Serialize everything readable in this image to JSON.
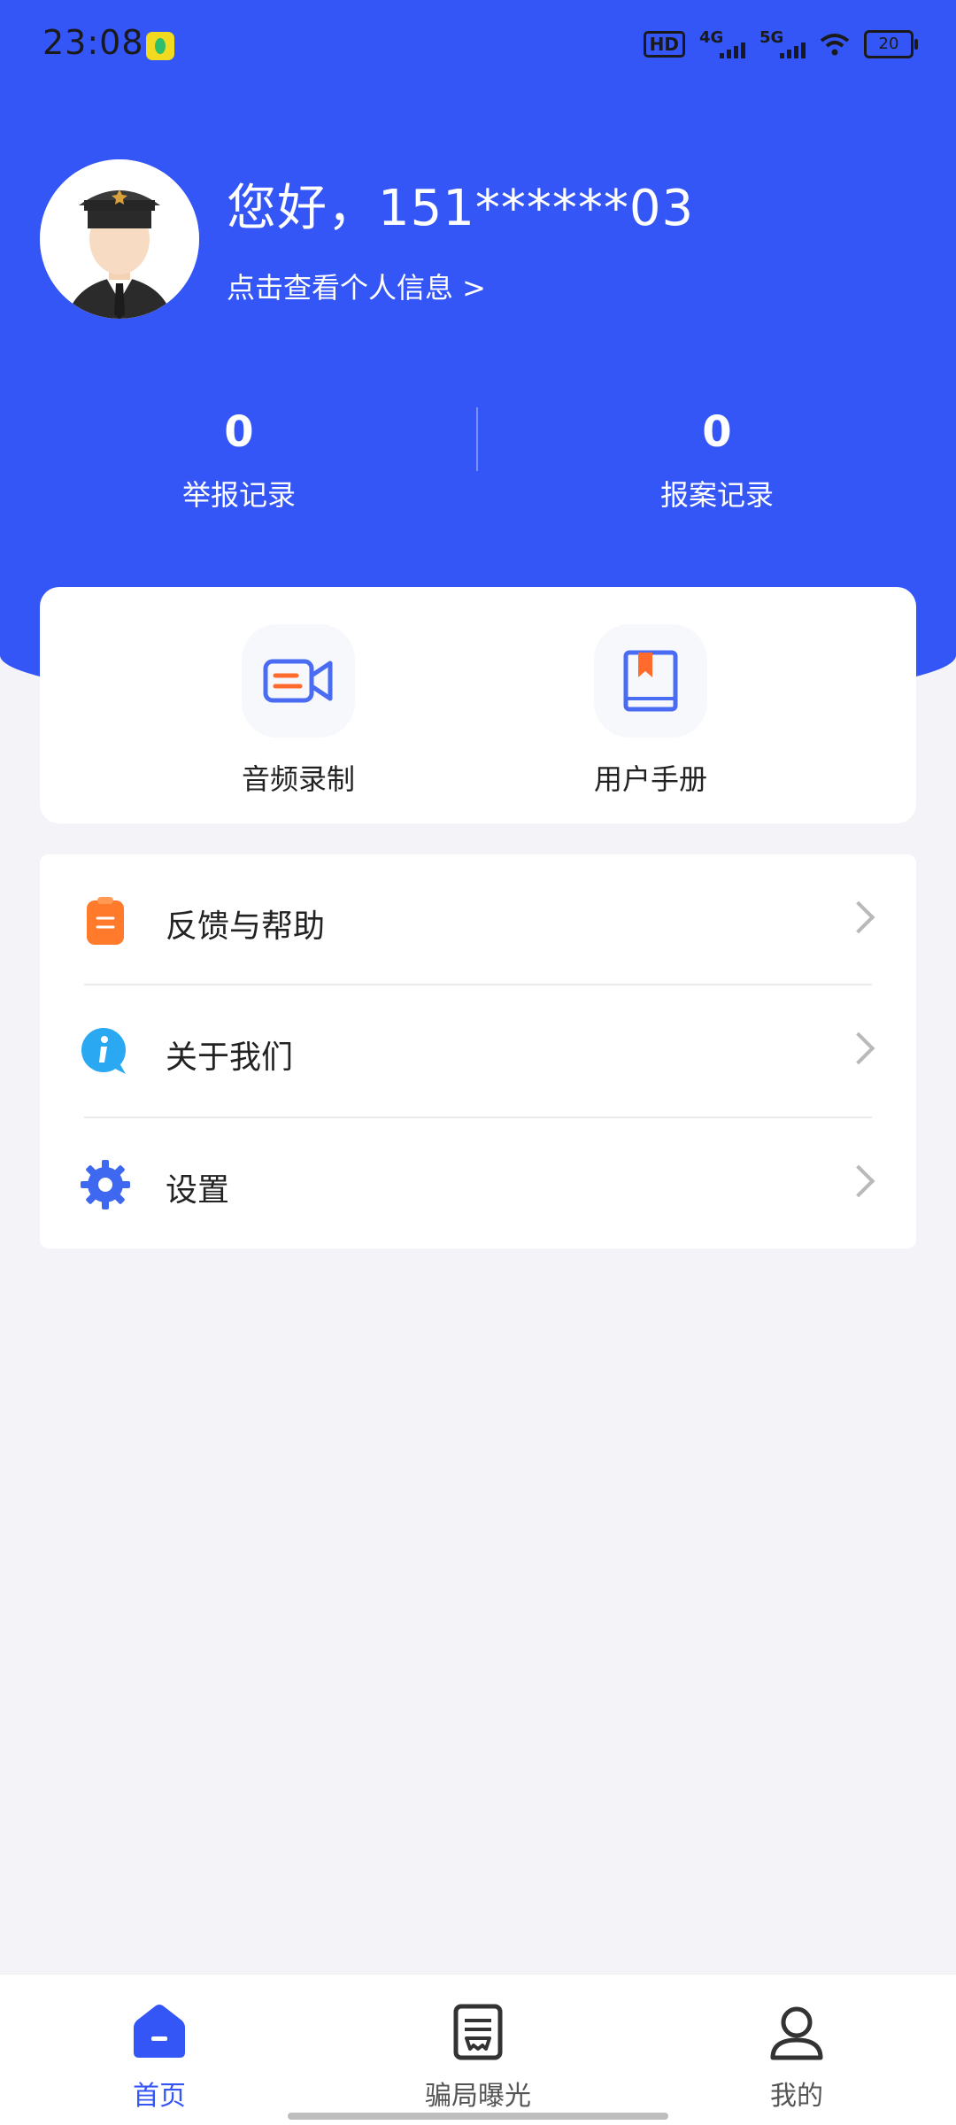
{
  "status_bar": {
    "time": "23:08",
    "hd": "HD",
    "network_1": "4G",
    "network_2": "5G",
    "battery": "20"
  },
  "profile": {
    "greeting": "您好，151******03",
    "link": "点击查看个人信息 >"
  },
  "stats": [
    {
      "value": "0",
      "label": "举报记录"
    },
    {
      "value": "0",
      "label": "报案记录"
    }
  ],
  "quick_actions": [
    {
      "label": "音频录制",
      "icon": "video-camera-icon"
    },
    {
      "label": "用户手册",
      "icon": "book-icon"
    }
  ],
  "menu": [
    {
      "label": "反馈与帮助",
      "icon": "clipboard-icon",
      "color": "#ff7a2b"
    },
    {
      "label": "关于我们",
      "icon": "info-icon",
      "color": "#2aa8f2"
    },
    {
      "label": "设置",
      "icon": "gear-icon",
      "color": "#3f68f0"
    }
  ],
  "bottom_nav": [
    {
      "label": "首页",
      "icon": "home-icon",
      "active": true
    },
    {
      "label": "骗局曝光",
      "icon": "document-icon",
      "active": false
    },
    {
      "label": "我的",
      "icon": "user-icon",
      "active": false
    }
  ],
  "colors": {
    "primary": "#3556f6",
    "background": "#f4f3f7"
  }
}
